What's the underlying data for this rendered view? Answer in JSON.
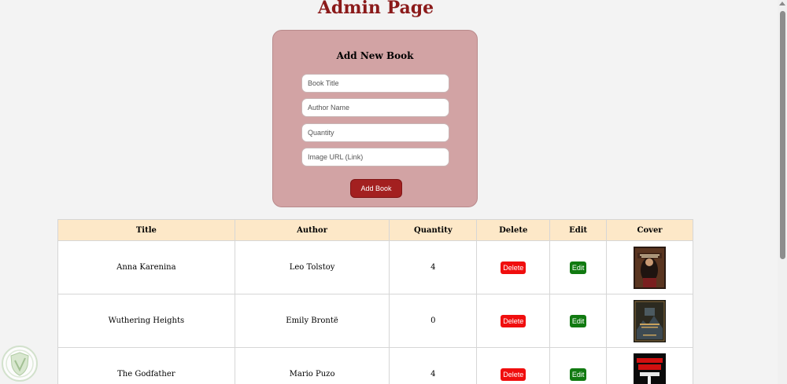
{
  "page": {
    "title": "Admin Page"
  },
  "form": {
    "title": "Add New Book",
    "fields": [
      {
        "placeholder": "Book Title",
        "value": ""
      },
      {
        "placeholder": "Author Name",
        "value": ""
      },
      {
        "placeholder": "Quantity",
        "value": ""
      },
      {
        "placeholder": "Image URL (Link)",
        "value": ""
      }
    ],
    "submit_label": "Add Book"
  },
  "table": {
    "headers": [
      "Title",
      "Author",
      "Quantity",
      "Delete",
      "Edit",
      "Cover"
    ],
    "rows": [
      {
        "title": "Anna Karenina",
        "author": "Leo Tolstoy",
        "quantity": "4",
        "delete_label": "Delete",
        "edit_label": "Edit",
        "cover_alt": "Anna Karenina cover"
      },
      {
        "title": "Wuthering Heights",
        "author": "Emily Brontë",
        "quantity": "0",
        "delete_label": "Delete",
        "edit_label": "Edit",
        "cover_alt": "Wuthering Heights cover"
      },
      {
        "title": "The Godfather",
        "author": "Mario Puzo",
        "quantity": "4",
        "delete_label": "Delete",
        "edit_label": "Edit",
        "cover_alt": "The Godfather cover"
      }
    ]
  },
  "colors": {
    "title": "#8b1a1a",
    "form_bg": "#d2a3a4",
    "add_button": "#a32020",
    "header_bg": "#fde8c8",
    "delete_button": "#f00e0e",
    "edit_button": "#117a11"
  },
  "icons": {
    "watermark": "shield-logo-icon",
    "scroll": "scroll-up-arrow-icon"
  }
}
